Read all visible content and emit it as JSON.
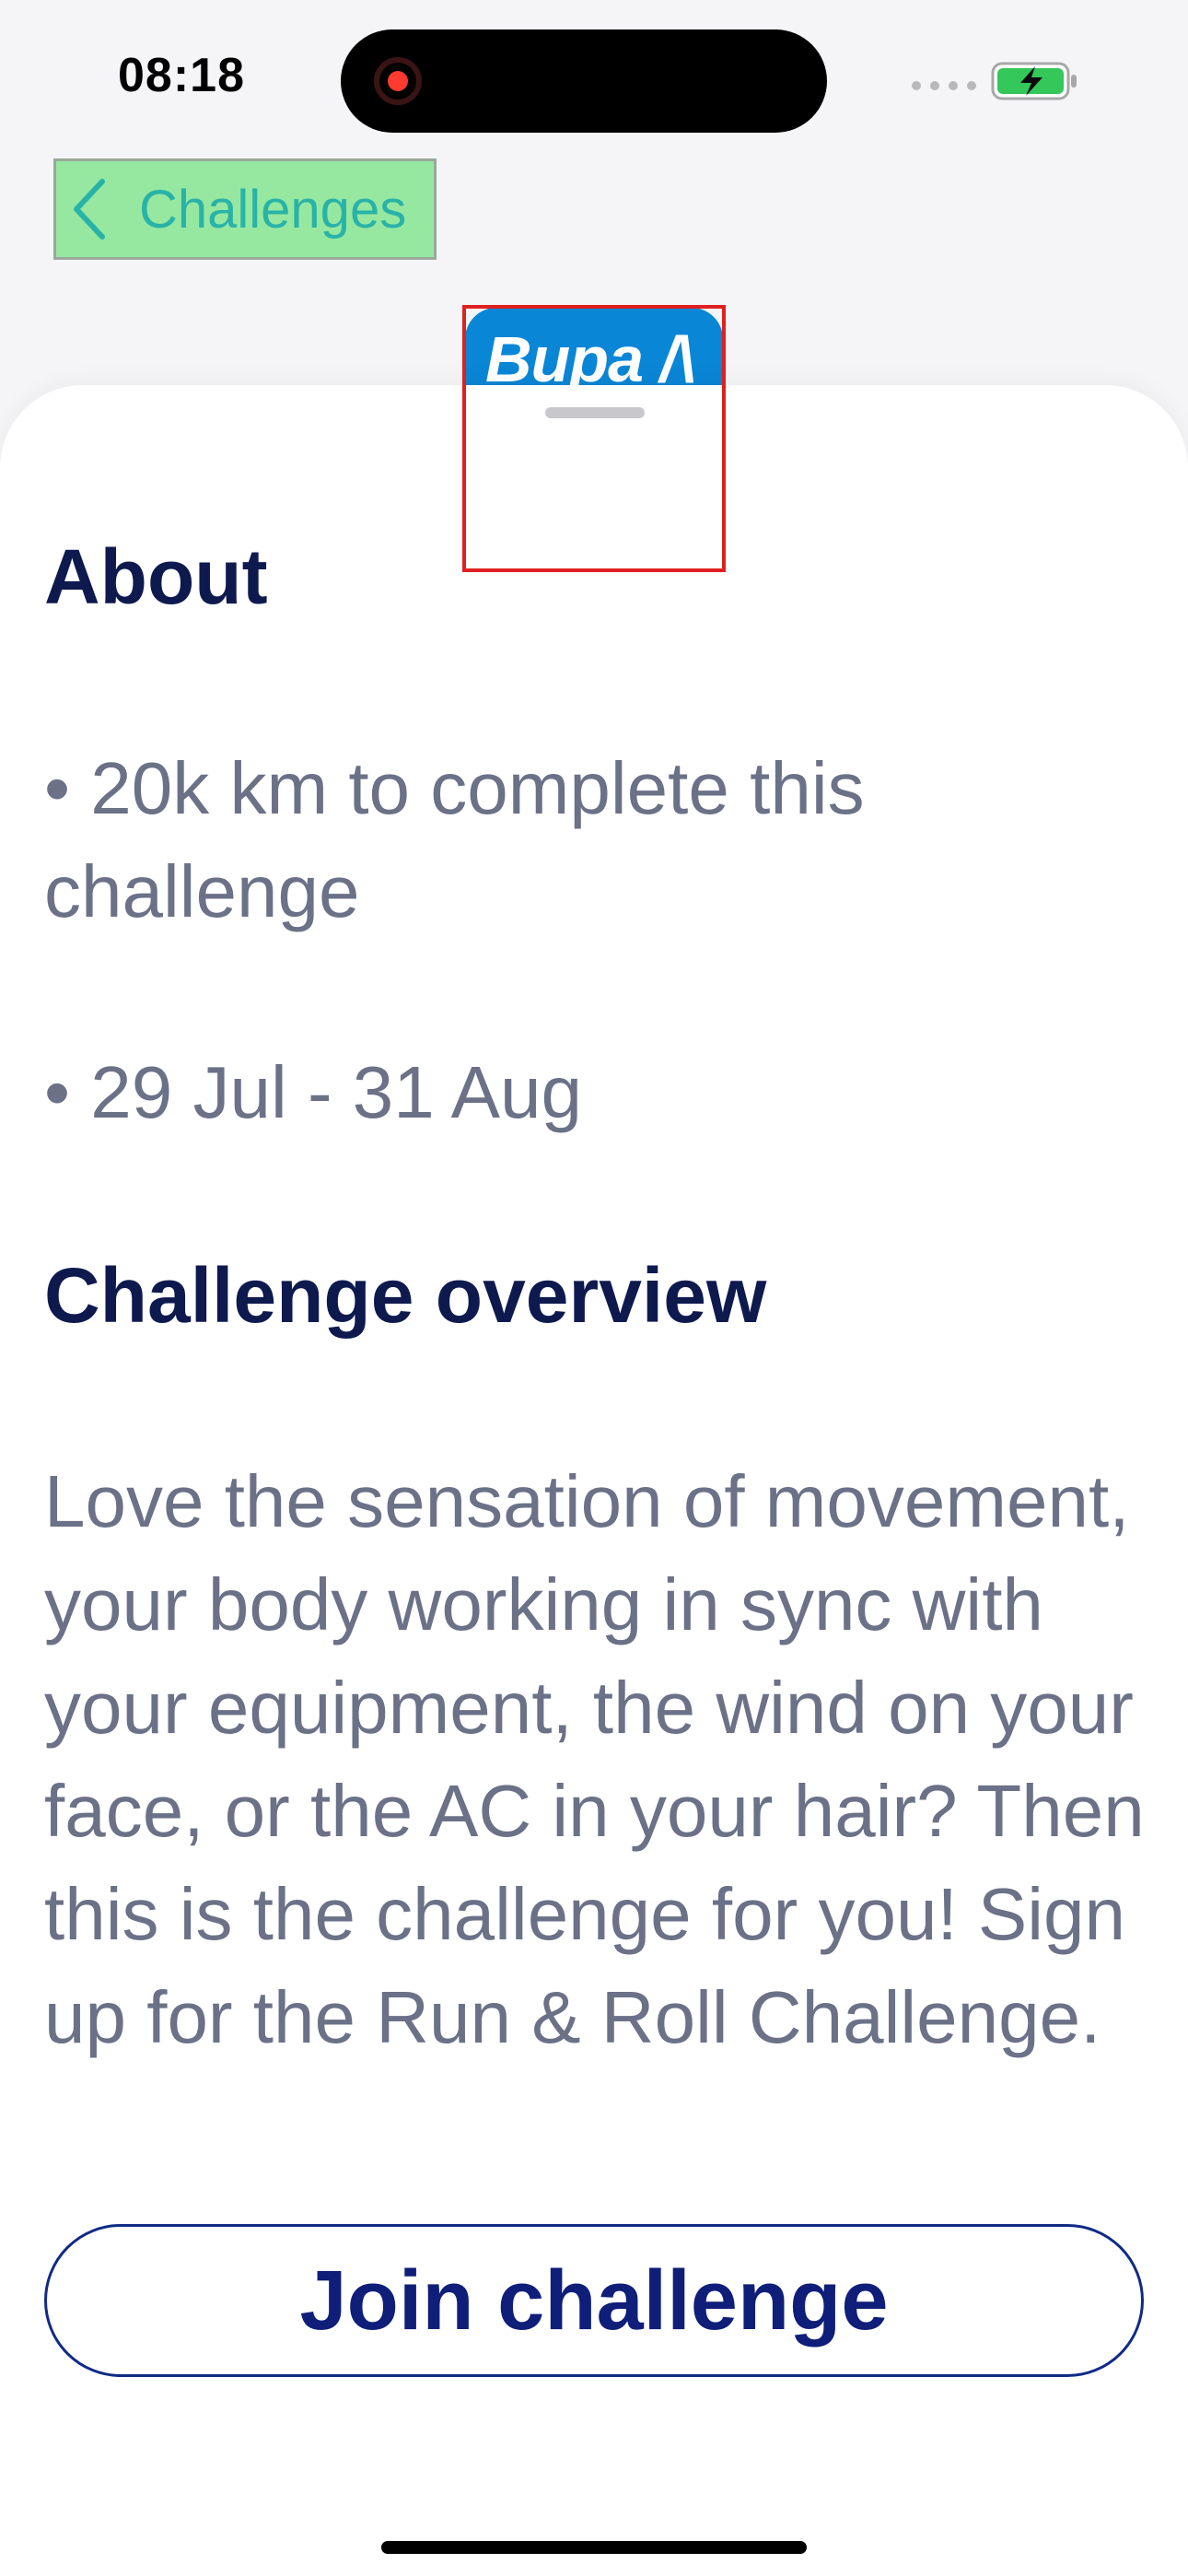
{
  "status_bar": {
    "time": "08:18"
  },
  "nav": {
    "back_label": "Challenges",
    "back_icon": "chevron-left-icon"
  },
  "logo": {
    "text": "Bupa /\\"
  },
  "content": {
    "about_heading": "About",
    "distance_text": "• 20k km to complete this challenge",
    "dates_text": "• 29 Jul - 31 Aug",
    "overview_heading": "Challenge overview",
    "overview_text": "Love the sensation of movement, your body working in sync with your equipment, the wind on your face, or the AC in your hair? Then this is the challenge for you! Sign up for the Run & Roll Challenge."
  },
  "actions": {
    "join_label": "Join challenge"
  },
  "colors": {
    "heading": "#0e1a4e",
    "body": "#6b7187",
    "accent": "#0f1e78",
    "back_text": "#29b3a8",
    "logo_bg": "#0a86d6"
  }
}
